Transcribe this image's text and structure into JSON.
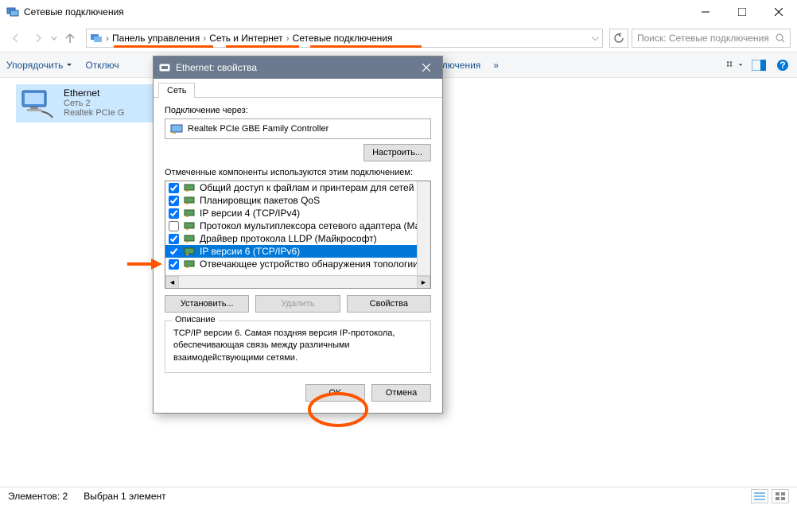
{
  "window": {
    "title": "Сетевые подключения"
  },
  "breadcrumb": {
    "items": [
      "Панель управления",
      "Сеть и Интернет",
      "Сетевые подключения"
    ]
  },
  "search": {
    "placeholder": "Поиск: Сетевые подключения"
  },
  "toolbar": {
    "organize": "Упорядочить",
    "disable": "Отключ",
    "rename": "еименование подключения"
  },
  "connection": {
    "name": "Ethernet",
    "network": "Сеть 2",
    "adapter": "Realtek PCIe G"
  },
  "statusbar": {
    "elements": "Элементов: 2",
    "selected": "Выбран 1 элемент"
  },
  "dialog": {
    "title": "Ethernet: свойства",
    "tab": "Сеть",
    "connect_via": "Подключение через:",
    "adapter": "Realtek PCIe GBE Family Controller",
    "configure": "Настроить...",
    "components_label": "Отмеченные компоненты используются этим подключением:",
    "components": [
      {
        "checked": true,
        "label": "Общий доступ к файлам и принтерам для сетей Mi"
      },
      {
        "checked": true,
        "label": "Планировщик пакетов QoS"
      },
      {
        "checked": true,
        "label": "IP версии 4 (TCP/IPv4)"
      },
      {
        "checked": false,
        "label": "Протокол мультиплексора сетевого адаптера (Май"
      },
      {
        "checked": true,
        "label": "Драйвер протокола LLDP (Майкрософт)"
      },
      {
        "checked": true,
        "label": "IP версии 6 (TCP/IPv6)",
        "selected": true
      },
      {
        "checked": true,
        "label": "Отвечающее устройство обнаружения топологии к"
      }
    ],
    "install": "Установить...",
    "uninstall": "Удалить",
    "properties": "Свойства",
    "description_label": "Описание",
    "description": "TCP/IP версии 6. Самая поздняя версия IP-протокола, обеспечивающая связь между различными взаимодействующими сетями.",
    "ok": "OK",
    "cancel": "Отмена"
  }
}
